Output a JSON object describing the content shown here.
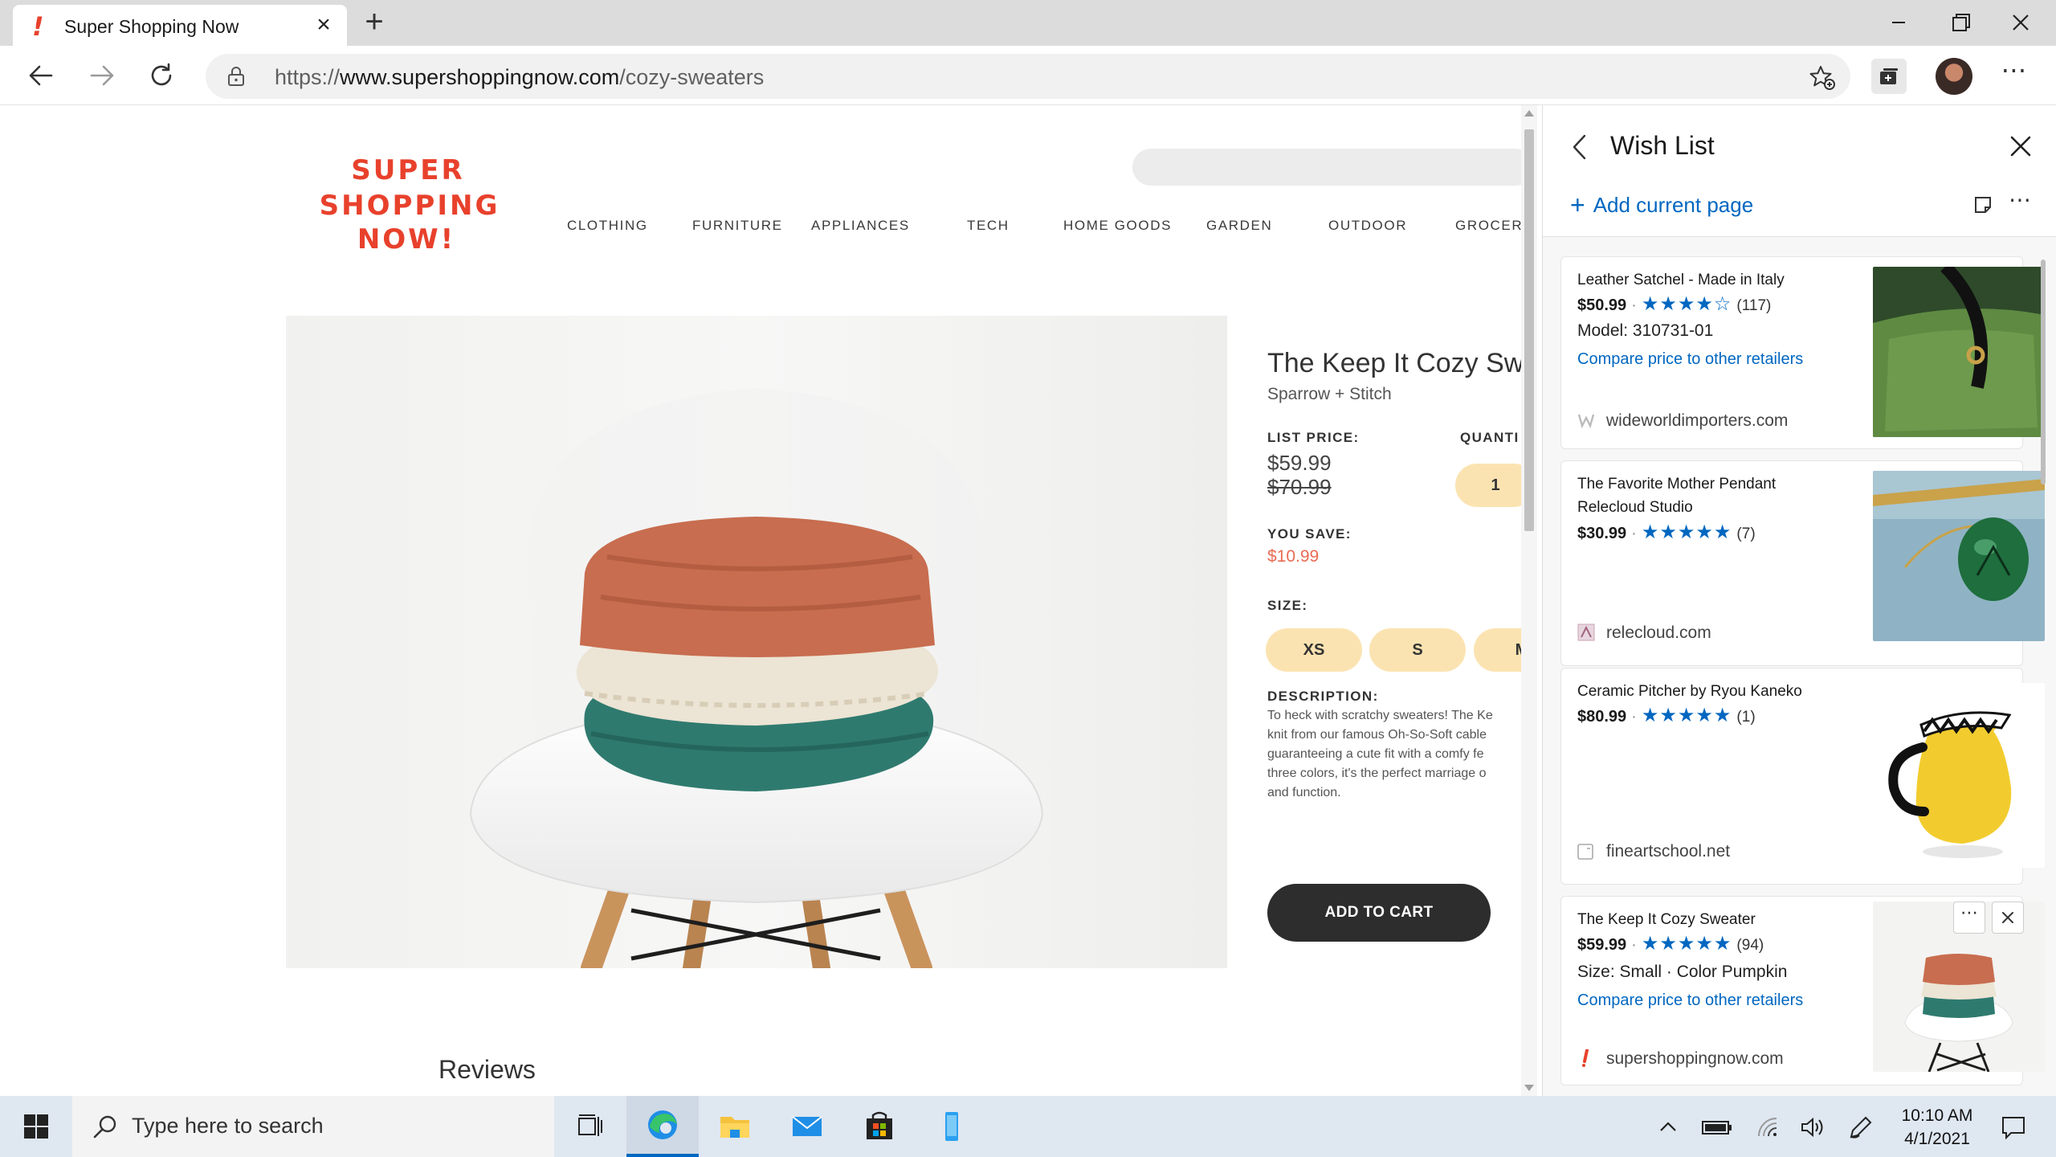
{
  "browser": {
    "tab": {
      "title": "Super Shopping Now",
      "favicon": "!",
      "close_label": "×"
    },
    "new_tab_label": "+",
    "address": {
      "scheme": "https://",
      "host": "www.supershoppingnow.com",
      "path": "/cozy-sweaters"
    },
    "more_label": "⋯"
  },
  "site": {
    "logo": {
      "line1": "SUPER",
      "line2": "SHOPPING",
      "line3": "NOW!",
      "color": "#e8412c"
    },
    "categories": [
      "CLOTHING",
      "FURNITURE",
      "APPLIANCES",
      "TECH",
      "HOME GOODS",
      "GARDEN",
      "OUTDOOR",
      "GROCERY"
    ],
    "product": {
      "title": "The Keep It Cozy Swe",
      "brand": "Sparrow + Stitch",
      "list_price_label": "LIST PRICE:",
      "price": "$59.99",
      "old_price": "$70.99",
      "quantity_label": "QUANTI",
      "quantity": "1",
      "you_save_label": "YOU SAVE:",
      "you_save": "$10.99",
      "size_label": "SIZE:",
      "sizes": [
        "XS",
        "S",
        "M"
      ],
      "description_label": "DESCRIPTION:",
      "description_lines": [
        "To heck with scratchy sweaters! The Ke",
        "knit from our famous Oh-So-Soft cable",
        "guaranteeing a cute fit with a comfy fe",
        "three colors, it's the perfect marriage o",
        "and function."
      ],
      "add_to_cart": "ADD TO CART"
    },
    "reviews_heading": "Reviews"
  },
  "wishlist": {
    "title": "Wish List",
    "add_current_page": "Add current page",
    "more_label": "⋯",
    "items": [
      {
        "title": "Leather Satchel - Made in Italy",
        "price": "$50.99",
        "stars": "★★★★☆",
        "rating": 4.5,
        "count": "(117)",
        "meta": "Model: 310731-01",
        "compare": "Compare price to other retailers",
        "domain": "wideworldimporters.com"
      },
      {
        "title": "The Favorite Mother Pendant Relecloud Studio",
        "price": "$30.99",
        "stars": "★★★★★",
        "rating": 5,
        "count": "(7)",
        "domain": "relecloud.com"
      },
      {
        "title": "Ceramic Pitcher by Ryou Kaneko",
        "price": "$80.99",
        "stars": "★★★★★",
        "rating": 5,
        "count": "(1)",
        "domain": "fineartschool.net"
      },
      {
        "title": "The Keep It Cozy Sweater",
        "price": "$59.99",
        "stars": "★★★★★",
        "rating": 5,
        "count": "(94)",
        "meta": "Size: Small · Color Pumpkin",
        "compare": "Compare price to other retailers",
        "domain": "supershoppingnow.com",
        "more_label": "⋯"
      }
    ]
  },
  "taskbar": {
    "search_placeholder": "Type here to search",
    "time": "10:10 AM",
    "date": "4/1/2021"
  },
  "colors": {
    "accent_blue": "#0067c0",
    "brand_red": "#e8412c",
    "pill_yellow": "#fbe3b1",
    "save_red": "#e86b52"
  }
}
